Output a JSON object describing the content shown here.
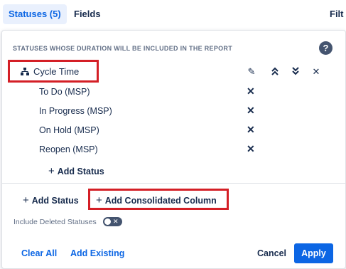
{
  "tabs": {
    "statuses": "Statuses (5)",
    "fields": "Fields",
    "filters": "Filt"
  },
  "panel": {
    "heading": "STATUSES WHOSE DURATION WILL BE INCLUDED IN THE REPORT",
    "help_icon": "?",
    "group": {
      "label": "Cycle Time",
      "icon": "hierarchy-icon",
      "actions": {
        "edit": "✎",
        "move_up": "⌃",
        "move_down": "⌄",
        "remove": "✕"
      }
    },
    "statuses": [
      {
        "label": "To Do (MSP)",
        "remove": "✕"
      },
      {
        "label": "In Progress (MSP)",
        "remove": "✕"
      },
      {
        "label": "On Hold (MSP)",
        "remove": "✕"
      },
      {
        "label": "Reopen (MSP)",
        "remove": "✕"
      }
    ],
    "add_status_inner": "Add Status",
    "add_status_outer": "Add Status",
    "add_consolidated": "Add Consolidated Column",
    "plus": "+",
    "include_deleted": "Include Deleted Statuses",
    "include_deleted_toggle": "off",
    "toggle_x": "✕"
  },
  "footer": {
    "clear_all": "Clear All",
    "add_existing": "Add Existing",
    "cancel": "Cancel",
    "apply": "Apply"
  },
  "colors": {
    "primary": "#0c66e4",
    "highlight": "#d41f26",
    "text": "#172b4d"
  }
}
